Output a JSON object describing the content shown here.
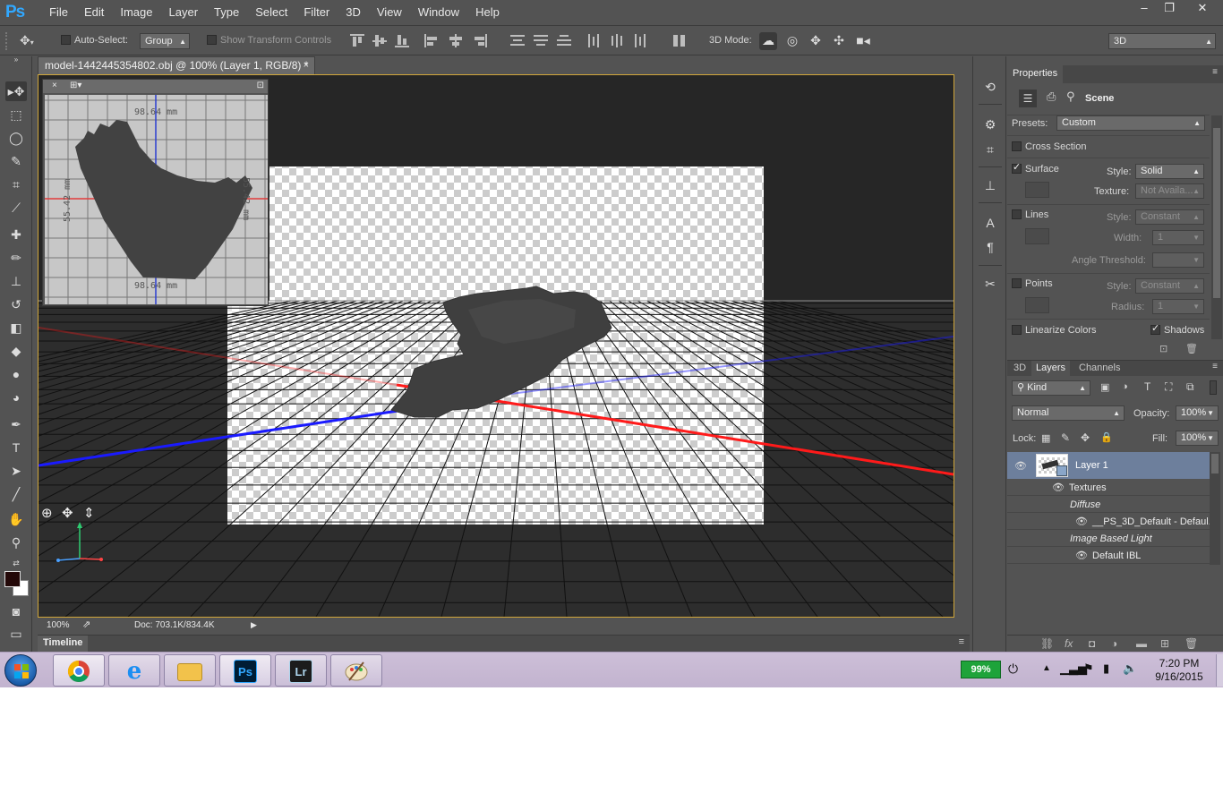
{
  "app": {
    "logo": "Ps",
    "menu": [
      "File",
      "Edit",
      "Image",
      "Layer",
      "Type",
      "Select",
      "Filter",
      "3D",
      "View",
      "Window",
      "Help"
    ],
    "window_controls": {
      "minimize": "–",
      "restore": "❐",
      "close": "✕"
    }
  },
  "options_bar": {
    "auto_select_label": "Auto-Select:",
    "auto_select_checked": false,
    "auto_select_target": "Group",
    "show_transform_controls_label": "Show Transform Controls",
    "show_transform_controls_checked": false,
    "mode_3d_label": "3D Mode:",
    "workspace": "3D"
  },
  "document": {
    "tab_title": "model-1442445354802.obj @ 100% (Layer 1, RGB/8) *",
    "tab_close": "×",
    "zoom": "100%",
    "doc_size": "Doc: 703.1K/834.4K",
    "secondary_view": {
      "dimension_top": "98.64 mm",
      "dimension_bottom": "98.64 mm",
      "dimension_left": "55.42 mm",
      "dimension_right": "55.42 mm"
    },
    "colors": {
      "x_axis": "#ff1a1a",
      "z_axis": "#1a1aff",
      "canvas_border": "#d1a73a",
      "background": "#282828",
      "grid": "#111111"
    }
  },
  "timeline": {
    "tab": "Timeline"
  },
  "properties": {
    "tab": "Properties",
    "section": "Scene",
    "presets_label": "Presets:",
    "presets_value": "Custom",
    "cross_section": {
      "label": "Cross Section",
      "checked": false
    },
    "surface": {
      "label": "Surface",
      "checked": true,
      "style_label": "Style:",
      "style_value": "Solid",
      "texture_label": "Texture:",
      "texture_value": "Not Availa..."
    },
    "lines": {
      "label": "Lines",
      "checked": false,
      "style_label": "Style:",
      "style_value": "Constant",
      "width_label": "Width:",
      "width_value": "1",
      "angle_label": "Angle Threshold:"
    },
    "points": {
      "label": "Points",
      "checked": false,
      "style_label": "Style:",
      "style_value": "Constant",
      "radius_label": "Radius:",
      "radius_value": "1"
    },
    "linearize_colors": {
      "label": "Linearize Colors",
      "checked": false
    },
    "shadows": {
      "label": "Shadows",
      "checked": true
    }
  },
  "layers_panel": {
    "tabs": [
      "3D",
      "Layers",
      "Channels"
    ],
    "active_tab": "Layers",
    "filter_kind": "Kind",
    "blend_mode": "Normal",
    "opacity_label": "Opacity:",
    "opacity_value": "100%",
    "lock_label": "Lock:",
    "fill_label": "Fill:",
    "fill_value": "100%",
    "layer_name": "Layer 1",
    "textures_label": "Textures",
    "diffuse_label": "Diffuse",
    "diffuse_texture": "__PS_3D_Default - Defaul...",
    "ibl_label": "Image Based Light",
    "ibl_value": "Default IBL"
  },
  "taskbar": {
    "battery": "99%",
    "time": "7:20 PM",
    "date": "9/16/2015",
    "apps": [
      "chrome",
      "internet-explorer",
      "file-explorer",
      "photoshop",
      "lightroom",
      "paint"
    ],
    "ps_label": "Ps",
    "lr_label": "Lr"
  }
}
